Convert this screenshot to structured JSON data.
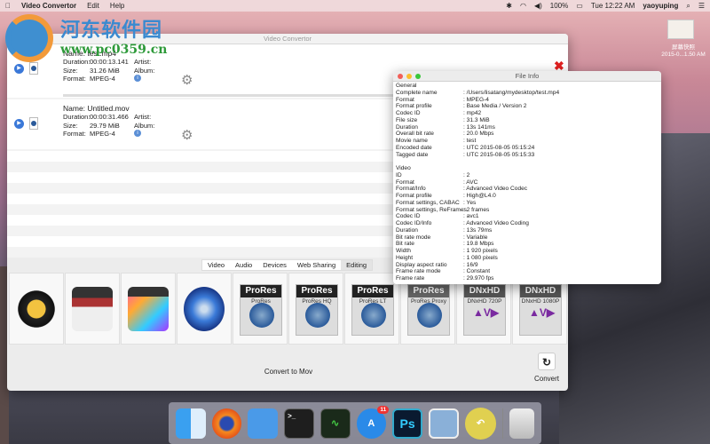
{
  "menubar": {
    "app": "Video Convertor",
    "items": [
      "Edit",
      "Help"
    ],
    "battery": "100%",
    "clock": "Tue 12:22 AM",
    "user": "yaoyuping"
  },
  "watermark": {
    "name": "河东软件园",
    "url": "www.pc0359.cn"
  },
  "desktop": {
    "file_label": "屏幕快照",
    "file_date": "2015-0...1.50 AM"
  },
  "main": {
    "title": "Video Convertor",
    "files": [
      {
        "name": "Name: test.mp4",
        "duration_label": "Duration:",
        "duration": "00:00:13.141",
        "size_label": "Size:",
        "size": "31.26 MiB",
        "format_label": "Format:",
        "format": "MPEG-4",
        "artist_label": "Artist:",
        "album_label": "Album:"
      },
      {
        "name": "Name: Untitled.mov",
        "duration_label": "Duration:",
        "duration": "00:00:31.466",
        "size_label": "Size:",
        "size": "29.79 MiB",
        "format_label": "Format:",
        "format": "MPEG-4",
        "artist_label": "Artist:",
        "album_label": "Album:"
      }
    ],
    "tabs": [
      "Video",
      "Audio",
      "Devices",
      "Web Sharing",
      "Editing"
    ],
    "active_tab": "Editing",
    "presets": [
      {
        "name": "iMovie"
      },
      {
        "name": "Final Cut"
      },
      {
        "name": "Final Cut Pro X"
      },
      {
        "name": "DVD"
      },
      {
        "badge": "ProRes",
        "label": "ProRes"
      },
      {
        "badge": "ProRes",
        "label": "ProRes HQ"
      },
      {
        "badge": "ProRes",
        "label": "ProRes LT"
      },
      {
        "badge": "ProRes",
        "label": "ProRes Proxy"
      },
      {
        "badge": "DNxHD",
        "label": "DNxHD 720P"
      },
      {
        "badge": "DNxHD",
        "label": "DNxHD 1080P"
      }
    ],
    "convert_to": "Convert to Mov",
    "convert_label": "Convert"
  },
  "fileinfo": {
    "title": "File Info",
    "general": [
      [
        "General",
        ""
      ],
      [
        "Complete name",
        ": /Users/lisatang/mydesktop/test.mp4"
      ],
      [
        "Format",
        ": MPEG-4"
      ],
      [
        "Format profile",
        ": Base Media / Version 2"
      ],
      [
        "Codec ID",
        ": mp42"
      ],
      [
        "File size",
        ": 31.3 MiB"
      ],
      [
        "Duration",
        ": 13s 141ms"
      ],
      [
        "Overall bit rate",
        ": 20.0 Mbps"
      ],
      [
        "Movie name",
        ": test"
      ],
      [
        "Encoded date",
        ": UTC 2015-08-05 05:15:24"
      ],
      [
        "Tagged date",
        ": UTC 2015-08-05 05:15:33"
      ]
    ],
    "video": [
      [
        "Video",
        ""
      ],
      [
        "ID",
        ": 2"
      ],
      [
        "Format",
        ": AVC"
      ],
      [
        "Format/Info",
        ": Advanced Video Codec"
      ],
      [
        "Format profile",
        ": High@L4.0"
      ],
      [
        "Format settings, CABAC",
        ": Yes"
      ],
      [
        "Format settings, ReFrames",
        ": 2 frames"
      ],
      [
        "Codec ID",
        ": avc1"
      ],
      [
        "Codec ID/Info",
        ": Advanced Video Coding"
      ],
      [
        "Duration",
        ": 13s 79ms"
      ],
      [
        "Bit rate mode",
        ": Variable"
      ],
      [
        "Bit rate",
        ": 19.8 Mbps"
      ],
      [
        "Width",
        ": 1 920 pixels"
      ],
      [
        "Height",
        ": 1 080 pixels"
      ],
      [
        "Display aspect ratio",
        ": 16/9"
      ],
      [
        "Frame rate mode",
        ": Constant"
      ],
      [
        "Frame rate",
        ": 29.970 fps"
      ]
    ]
  },
  "dock": [
    {
      "name": "Finder"
    },
    {
      "name": "Firefox"
    },
    {
      "name": "Xcode"
    },
    {
      "name": "Terminal",
      "glyph": ">_"
    },
    {
      "name": "Activity Monitor"
    },
    {
      "name": "App Store",
      "glyph": "A",
      "badge": "11"
    },
    {
      "name": "Photoshop",
      "glyph": "Ps"
    },
    {
      "name": "Preview"
    },
    {
      "name": "Convertor"
    },
    {
      "name": "Trash"
    }
  ]
}
